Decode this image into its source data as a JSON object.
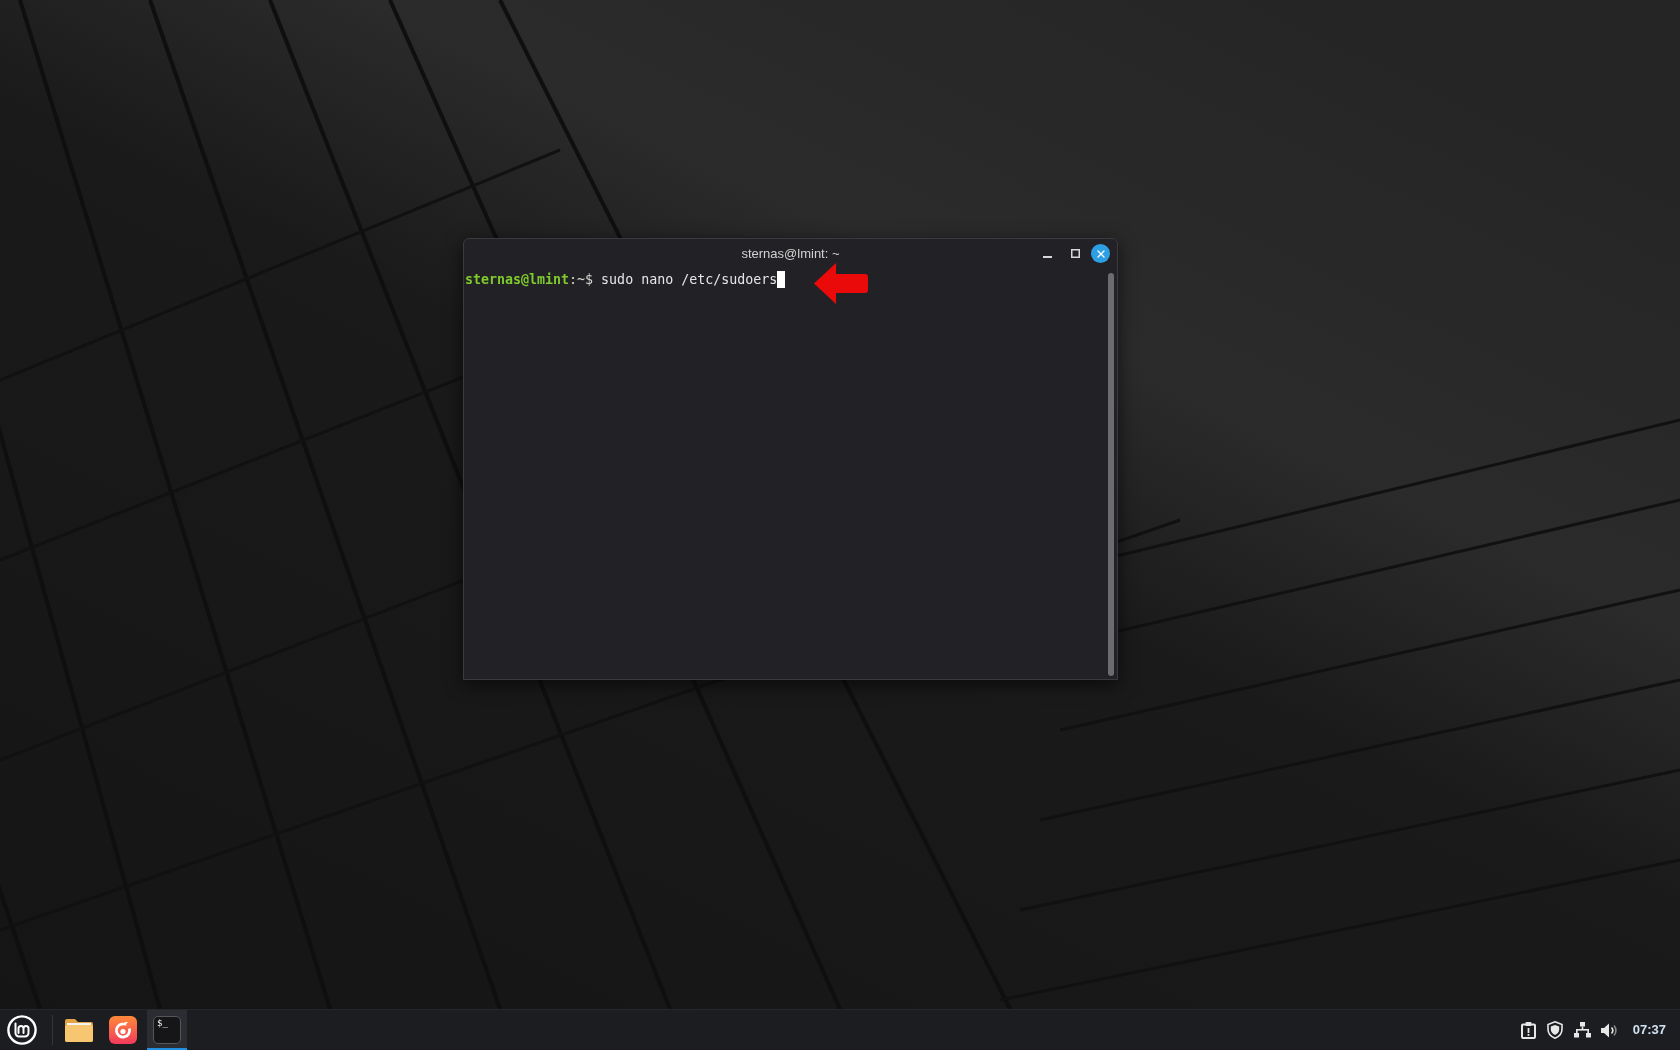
{
  "window": {
    "title": "sternas@lmint: ~"
  },
  "terminal": {
    "lines": [
      {
        "user_host": "sternas@lmint",
        "prompt": ":~$",
        "command": "sudo nano /etc/sudoers"
      }
    ]
  },
  "taskbar": {
    "launchers": [
      {
        "kind": "files",
        "selected": false
      },
      {
        "kind": "browser",
        "selected": false
      },
      {
        "kind": "terminal",
        "glyph": "$_",
        "selected": true
      }
    ],
    "clock": "07:37"
  }
}
